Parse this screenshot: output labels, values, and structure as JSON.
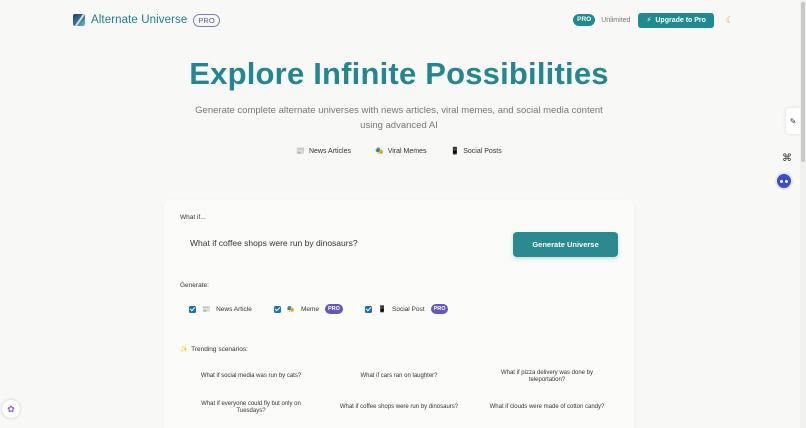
{
  "header": {
    "brand": "Alternate Universe",
    "brand_badge": "PRO",
    "plan_badge": "PRO",
    "plan_label": "Unlimited",
    "upgrade_label": "Upgrade to Pro",
    "upgrade_icon": "bolt-icon",
    "theme_icon": "moon-icon"
  },
  "hero": {
    "title": "Explore Infinite Possibilities",
    "subtitle": "Generate complete alternate universes with news articles, viral memes, and social media content using advanced AI",
    "features": [
      {
        "icon": "newspaper-icon",
        "label": "News Articles"
      },
      {
        "icon": "meme-icon",
        "label": "Viral Memes"
      },
      {
        "icon": "phone-icon",
        "label": "Social Posts"
      }
    ]
  },
  "form": {
    "whatif_label": "What if...",
    "input_value": "What if coffee shops were run by dinosaurs?",
    "generate_button": "Generate Universe",
    "generate_label": "Generate:",
    "options": [
      {
        "label": "News Article",
        "checked": true,
        "pro": ""
      },
      {
        "label": "Meme",
        "checked": true,
        "pro": "PRO"
      },
      {
        "label": "Social Post",
        "checked": true,
        "pro": "PRO"
      }
    ],
    "trending_label": "Trending scenarios:",
    "trending": [
      "What if social media was run by cats?",
      "What if cars ran on laughter?",
      "What if pizza delivery was done by teleportation?",
      "What if everyone could fly but only on Tuesdays?",
      "What if coffee shops were run by dinosaurs?",
      "What if clouds were made of cotton candy?"
    ]
  },
  "colors": {
    "accent": "#26868f",
    "pro_purple": "#6457b5",
    "checkbox": "#1e6fb8"
  }
}
